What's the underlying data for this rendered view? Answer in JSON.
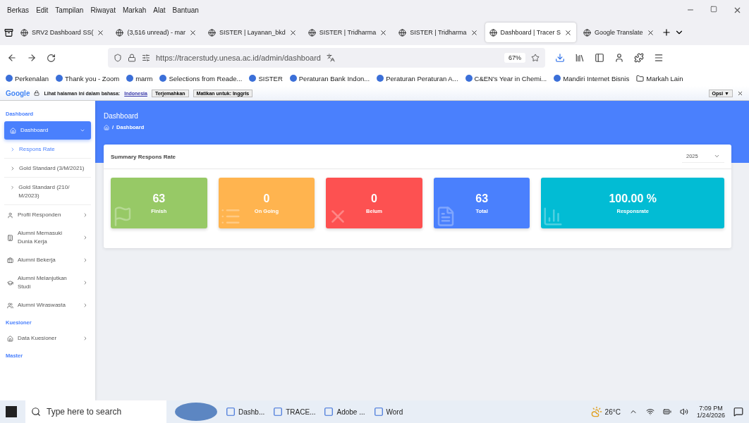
{
  "menu_bar": [
    "Berkas",
    "Edit",
    "Tampilan",
    "Riwayat",
    "Markah",
    "Alat",
    "Bantuan"
  ],
  "tabs": [
    {
      "label": "SRV2 Dashboard SS(",
      "selected": false
    },
    {
      "label": "(3,516 unread) - mar",
      "selected": false
    },
    {
      "label": "SISTER | Layanan_bkd",
      "selected": false
    },
    {
      "label": "SISTER | Tridharma",
      "selected": false
    },
    {
      "label": "SISTER | Tridharma",
      "selected": false
    },
    {
      "label": "Dashboard | Tracer S",
      "selected": true
    },
    {
      "label": "Google Translate",
      "selected": false
    }
  ],
  "address": {
    "url": "https://tracerstudy.unesa.ac.id/admin/dashboard",
    "zoom": "67%"
  },
  "bookmarks": [
    "Perkenalan",
    "Thank you - Zoom",
    "marm",
    "Selections from Reade...",
    "SISTER",
    "Peraturan Bank Indon...",
    "Peraturan Peraturan A...",
    "C&EN's Year in Chemi...",
    "Mandiri Internet Bisnis",
    "Markah Lain"
  ],
  "translate_bar": {
    "logo": "Google",
    "prompt": "Lihat halaman ini dalam bahasa:",
    "language": "Indonesia",
    "translate_button": "Terjemahkan",
    "off_button": "Matikan untuk: Inggris",
    "options_button": "Opsi ▼"
  },
  "sidebar": [
    {
      "heading": "Dashboard",
      "items": [
        {
          "label": "Dashboard",
          "selected": true,
          "expanded": true,
          "children": [
            {
              "label": "Respons Rate",
              "selected": true
            },
            {
              "label": "Gold Standard (3/M/2021)",
              "selected": false
            },
            {
              "label": "Gold Standard (210/ M/2023)",
              "selected": false
            }
          ]
        },
        {
          "label": "Profil Responden",
          "selected": false,
          "expanded": false
        },
        {
          "label": "Alumni Memasuki Dunia Kerja",
          "selected": false,
          "expanded": false
        },
        {
          "label": "Alumni Bekerja",
          "selected": false,
          "expanded": false
        },
        {
          "label": "Alumni Melanjutkan Studi",
          "selected": false,
          "expanded": false
        },
        {
          "label": "Alumni Wiraswasta",
          "selected": false,
          "expanded": false
        }
      ]
    },
    {
      "heading": "Kuesioner",
      "items": [
        {
          "label": "Data Kuesioner",
          "selected": false,
          "expanded": false
        }
      ]
    },
    {
      "heading": "Master"
    }
  ],
  "page": {
    "title": "Dashboard",
    "breadcrumb_separator": "/",
    "breadcrumb": "Dashboard"
  },
  "summary": {
    "title": "Summary Respons Rate",
    "year": "2025",
    "stats": [
      {
        "value": "63",
        "label": "Finish",
        "color": "#97c966"
      },
      {
        "value": "0",
        "label": "On Going",
        "color": "#ffb44f"
      },
      {
        "value": "0",
        "label": "Belum",
        "color": "#fd5151"
      },
      {
        "value": "63",
        "label": "Total",
        "color": "#4a80fd"
      },
      {
        "value": "100.00 %",
        "label": "Responsrate",
        "color": "#02bcd4"
      }
    ]
  },
  "taskbar": {
    "search_placeholder": "Type here to search",
    "apps": [
      {
        "label": "Dashb..."
      },
      {
        "label": "TRACE..."
      },
      {
        "label": "Adobe ..."
      },
      {
        "label": "Word"
      }
    ],
    "temperature": "26°C",
    "time": "7:09 PM",
    "date": "1/24/2026"
  }
}
